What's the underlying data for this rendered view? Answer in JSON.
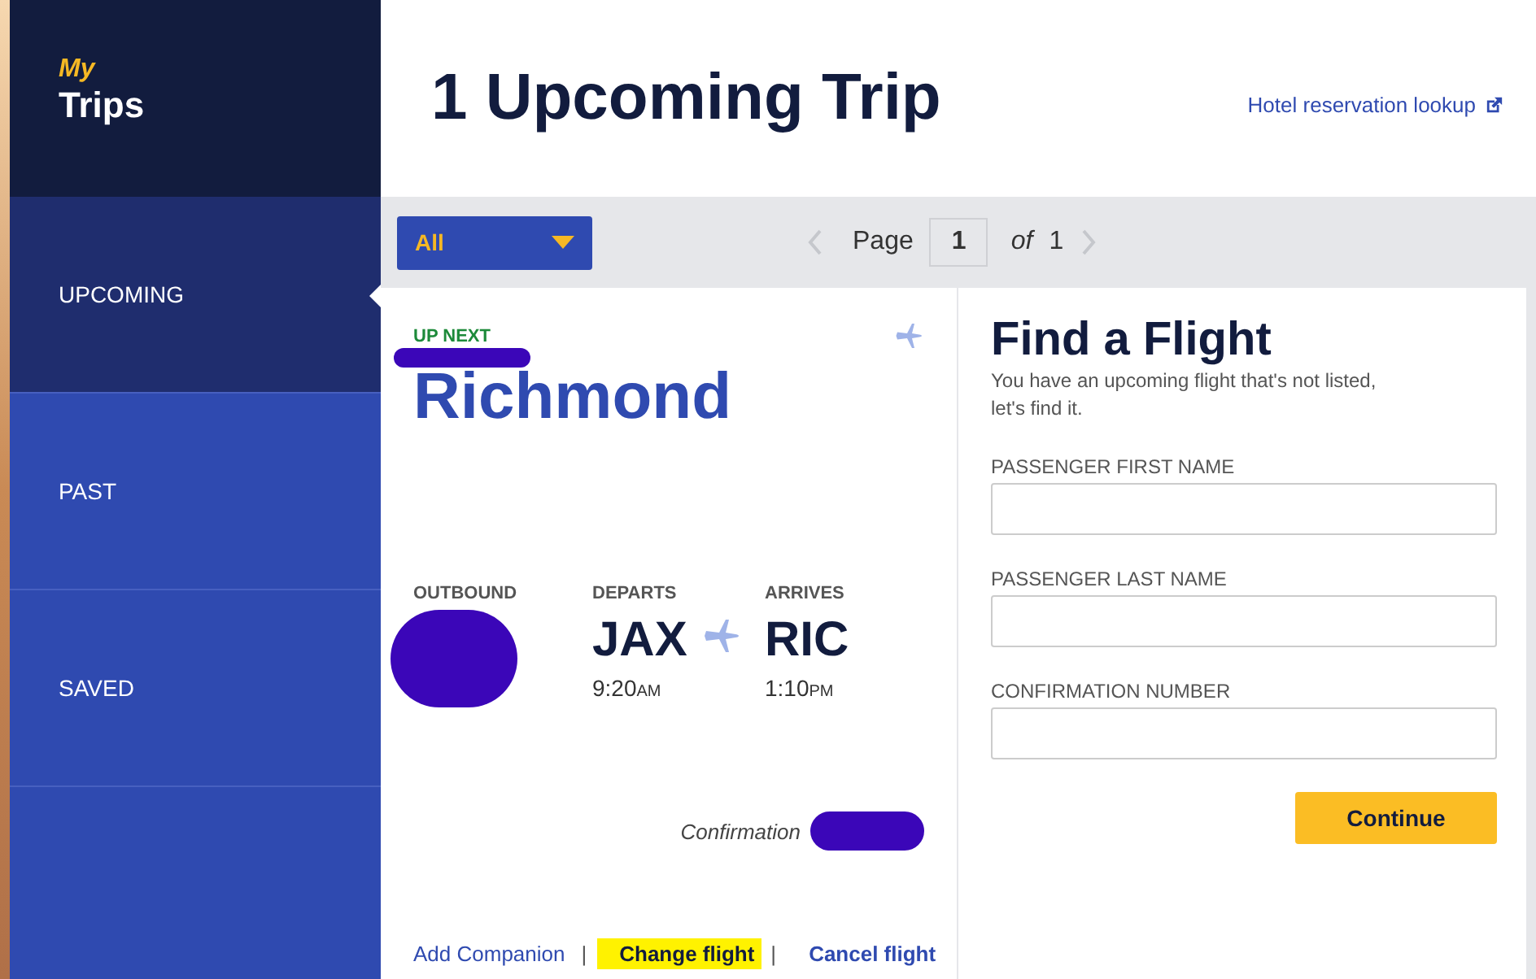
{
  "sidebar": {
    "brand_top": "My",
    "brand_bottom": "Trips",
    "items": [
      {
        "label": "UPCOMING",
        "selected": true
      },
      {
        "label": "PAST",
        "selected": false
      },
      {
        "label": "SAVED",
        "selected": false
      }
    ]
  },
  "header": {
    "title": "1 Upcoming Trip",
    "link": "Hotel reservation lookup"
  },
  "toolbar": {
    "filter": "All",
    "page_label": "Page",
    "page": "1",
    "of_label": "of",
    "total": "1"
  },
  "trip": {
    "badge": "UP NEXT",
    "city": "Richmond",
    "outbound_label": "OUTBOUND",
    "departs_label": "DEPARTS",
    "arrives_label": "ARRIVES",
    "from": "JAX",
    "to": "RIC",
    "depart_time": "9:20",
    "depart_ampm": "AM",
    "arrive_time": "1:10",
    "arrive_ampm": "PM",
    "confirmation_label": "Confirmation",
    "separator": "|",
    "actions": [
      {
        "label": "Add Companion",
        "highlighted": false
      },
      {
        "label": "Change flight",
        "highlighted": true
      },
      {
        "label": "Cancel flight",
        "highlighted": false
      }
    ]
  },
  "find": {
    "title": "Find a Flight",
    "subtitle_1": "You have an upcoming flight that's not listed,",
    "subtitle_2": "let's find it.",
    "fields": [
      {
        "label": "PASSENGER FIRST NAME"
      },
      {
        "label": "PASSENGER LAST NAME"
      },
      {
        "label": "CONFIRMATION NUMBER"
      }
    ],
    "button": "Continue"
  }
}
